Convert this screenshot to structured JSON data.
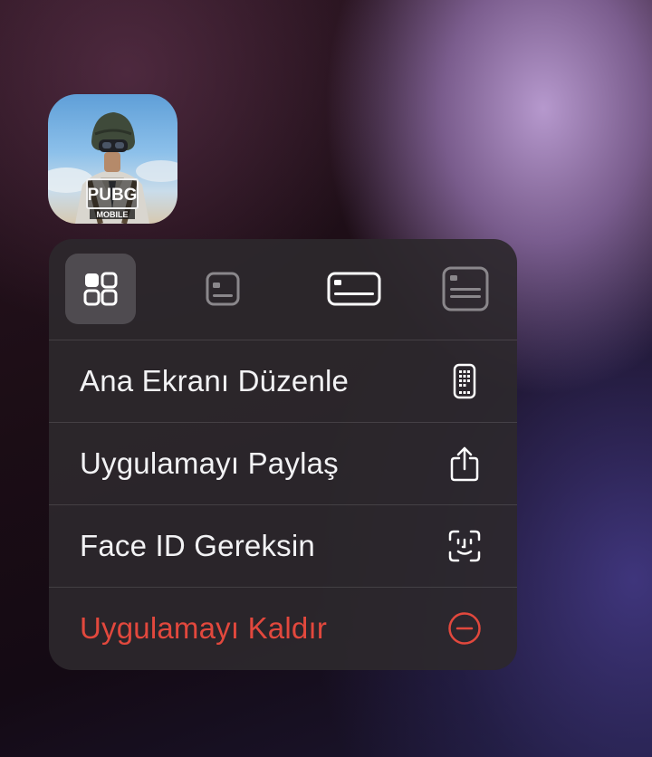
{
  "app": {
    "name": "PUBG MOBILE",
    "logo_text": "PUBG",
    "logo_subtext": "MOBILE",
    "icon": "pubg-app-icon"
  },
  "widget_sizes": [
    {
      "icon": "app-grid-icon",
      "selected": true
    },
    {
      "icon": "small-widget-icon",
      "selected": false
    },
    {
      "icon": "medium-widget-icon",
      "selected": false
    },
    {
      "icon": "large-widget-icon",
      "selected": false
    }
  ],
  "menu": {
    "items": [
      {
        "label": "Ana Ekranı Düzenle",
        "icon": "phone-apps-icon",
        "destructive": false
      },
      {
        "label": "Uygulamayı Paylaş",
        "icon": "share-icon",
        "destructive": false
      },
      {
        "label": "Face ID Gereksin",
        "icon": "face-id-icon",
        "destructive": false
      },
      {
        "label": "Uygulamayı Kaldır",
        "icon": "minus-circle-icon",
        "destructive": true
      }
    ]
  },
  "colors": {
    "destructive": "#e2483d",
    "text": "#f2f2f4",
    "menu_background": "#2c282c"
  }
}
